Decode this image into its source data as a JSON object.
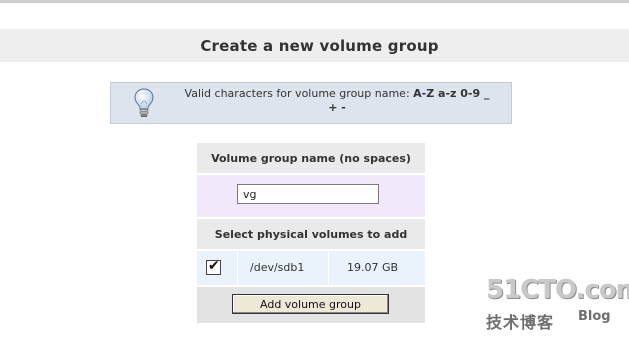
{
  "page": {
    "title": "Create a new volume group"
  },
  "tip": {
    "icon": "lightbulb-icon",
    "text": "Valid characters for volume group name:",
    "chars": "A-Z a-z 0-9 _",
    "chars_cont": "+ -"
  },
  "form": {
    "name_header": "Volume group name (no spaces)",
    "name_value": "vg",
    "pv_header": "Select physical volumes to add",
    "physical_volumes": [
      {
        "checked": true,
        "device": "/dev/sdb1",
        "size": "19.07 GB"
      }
    ],
    "submit_label": "Add volume group"
  },
  "watermark": {
    "main": "51CTO.com",
    "sub": "技术博客",
    "blog": "Blog"
  }
}
